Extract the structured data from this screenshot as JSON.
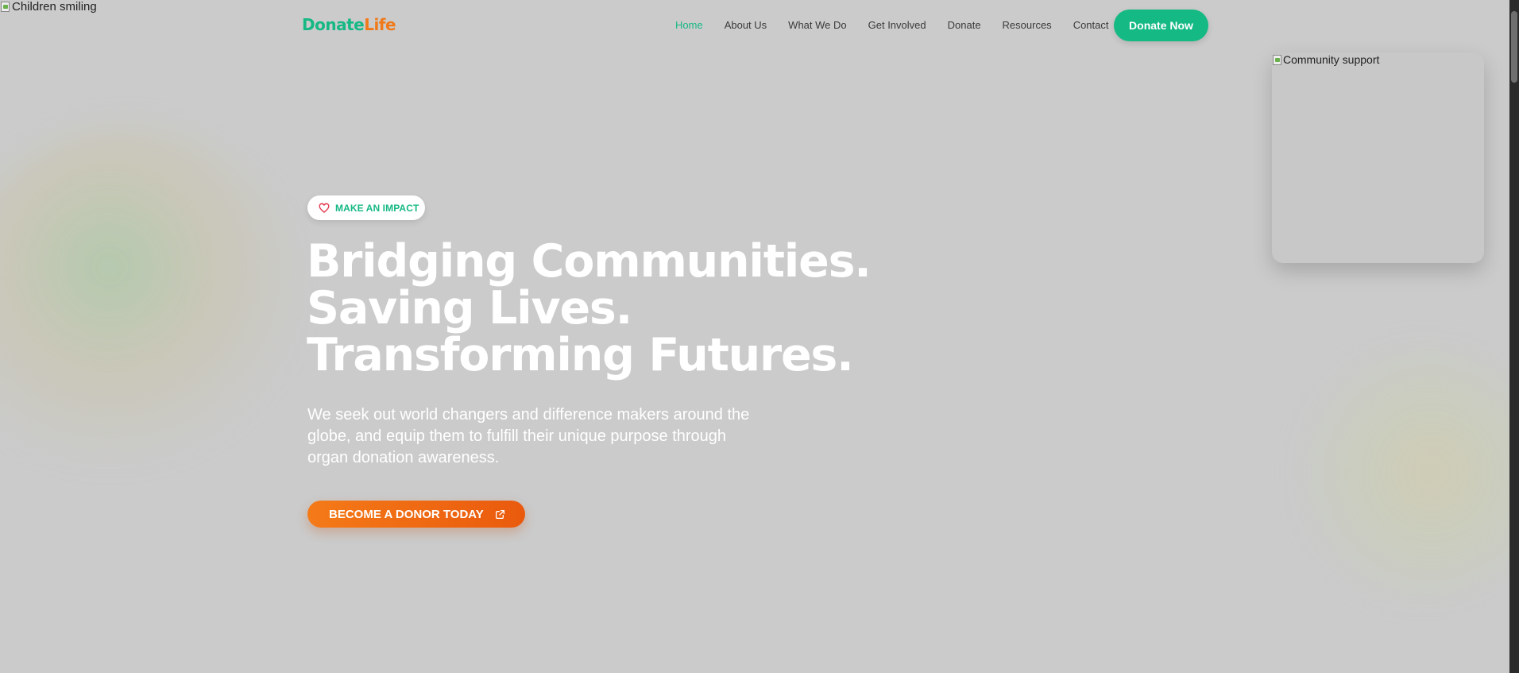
{
  "background_image": {
    "alt": "Children smiling"
  },
  "brand": {
    "part1": "Donate",
    "part2": "Life",
    "color_primary": "#16b884",
    "color_accent": "#f07a1a"
  },
  "nav": {
    "items": [
      {
        "label": "Home",
        "active": true
      },
      {
        "label": "About Us"
      },
      {
        "label": "What We Do"
      },
      {
        "label": "Get Involved"
      },
      {
        "label": "Donate"
      },
      {
        "label": "Resources"
      },
      {
        "label": "Contact"
      }
    ],
    "cta": "Donate Now"
  },
  "side_card": {
    "alt": "Community support"
  },
  "hero": {
    "badge": "MAKE AN IMPACT",
    "heading_lines": [
      "Bridging Communities.",
      "Saving Lives.",
      "Transforming Futures."
    ],
    "subtitle": "We seek out world changers and difference makers around the globe, and equip them to fulfill their unique purpose through organ donation awareness.",
    "cta": "BECOME A DONOR TODAY"
  },
  "icons": {
    "badge": "heart-icon",
    "cta": "external-link-icon"
  }
}
